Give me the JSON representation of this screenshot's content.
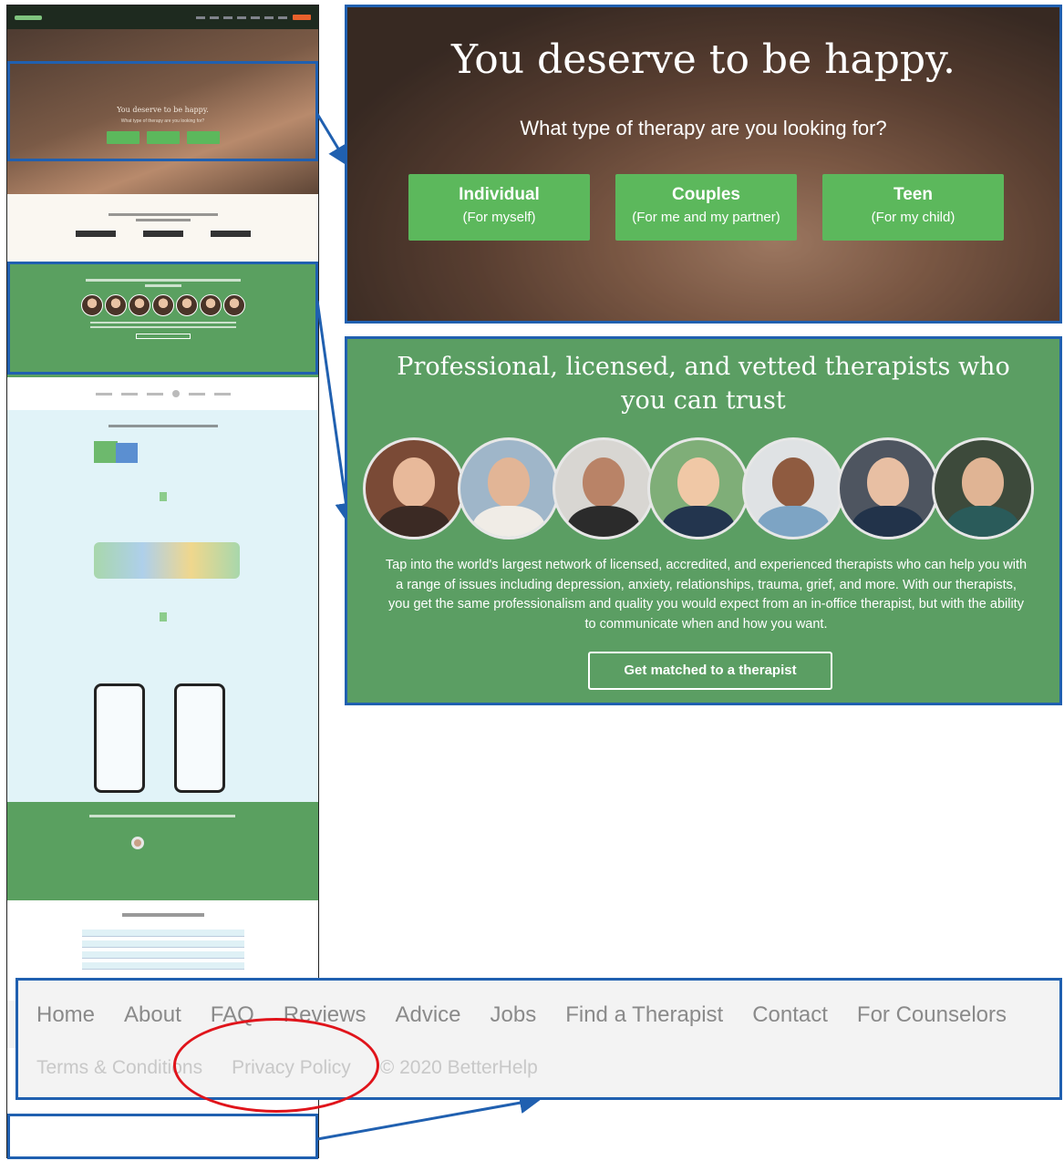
{
  "hero": {
    "title": "You deserve to be happy.",
    "question": "What type of therapy are you looking for?",
    "options": [
      {
        "label": "Individual",
        "sub": "(For myself)"
      },
      {
        "label": "Couples",
        "sub": "(For me and my partner)"
      },
      {
        "label": "Teen",
        "sub": "(For my child)"
      }
    ]
  },
  "therapists": {
    "title": "Professional, licensed, and vetted therapists who you can trust",
    "body": "Tap into the world's largest network of licensed, accredited, and experienced therapists who can help you with a range of issues including depression, anxiety, relationships, trauma, grief, and more. With our therapists, you get the same professionalism and quality you would expect from an in-office therapist, but with the ability to communicate when and how you want.",
    "cta": "Get matched to a therapist"
  },
  "footer": {
    "links": [
      "Home",
      "About",
      "FAQ",
      "Reviews",
      "Advice",
      "Jobs",
      "Find a Therapist",
      "Contact",
      "For Counselors"
    ],
    "legal": [
      "Terms & Conditions",
      "Privacy Policy",
      "© 2020 BetterHelp"
    ]
  },
  "colors": {
    "accent_green": "#5cb85c",
    "section_green": "#5b9e63",
    "annotation_blue": "#2060b0",
    "annotation_red": "#e0141b"
  }
}
